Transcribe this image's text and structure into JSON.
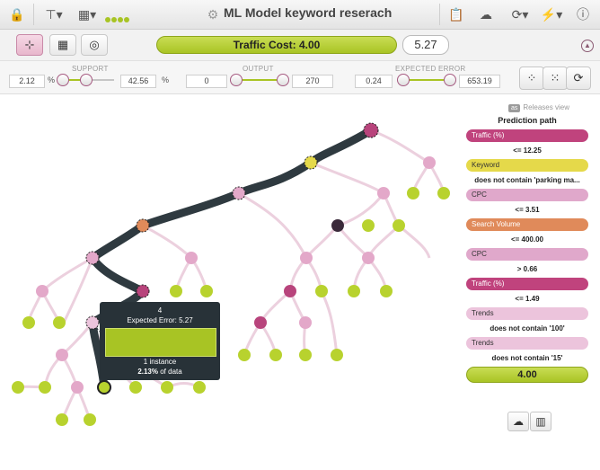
{
  "app": {
    "title": "ML Model keyword reserach"
  },
  "header": {
    "traffic_cost_label": "Traffic Cost: 4.00",
    "traffic_cost_value": "5.27"
  },
  "filters": {
    "support": {
      "label": "SUPPORT",
      "min": "2.12",
      "max": "42.56",
      "unit": "%"
    },
    "output": {
      "label": "OUTPUT",
      "min": "0",
      "max": "270"
    },
    "expected_error": {
      "label": "EXPECTED ERROR",
      "min": "0.24",
      "max": "653.19"
    }
  },
  "releases": {
    "tag": "as",
    "label": "Releases view"
  },
  "prediction_path": {
    "title": "Prediction path",
    "steps": [
      {
        "field": "Traffic (%)",
        "condition": "<= 12.25",
        "color": "#c0437d"
      },
      {
        "field": "Keyword",
        "condition": "does not contain 'parking ma...",
        "color": "#e5d94a"
      },
      {
        "field": "CPC",
        "condition": "<= 3.51",
        "color": "#e0a8cb"
      },
      {
        "field": "Search Volume",
        "condition": "<= 400.00",
        "color": "#e08a5a"
      },
      {
        "field": "CPC",
        "condition": "> 0.66",
        "color": "#e0a8cb"
      },
      {
        "field": "Traffic (%)",
        "condition": "<= 1.49",
        "color": "#c0437d"
      },
      {
        "field": "Trends",
        "condition": "does not contain '100'",
        "color": "#ecc4dc"
      },
      {
        "field": "Trends",
        "condition": "does not contain '15'",
        "color": "#ecc4dc"
      }
    ],
    "result": "4.00"
  },
  "tooltip": {
    "value": "4",
    "expected_error": "Expected Error: 5.27",
    "instances": "1 instance",
    "percent": "2.13%",
    "percent_suffix": " of data"
  },
  "colors": {
    "accent": "#a8c424",
    "path": "#2f3a40",
    "node_pink": "#e3a8c9",
    "node_magenta": "#b8447c",
    "node_green": "#b8d22e"
  }
}
